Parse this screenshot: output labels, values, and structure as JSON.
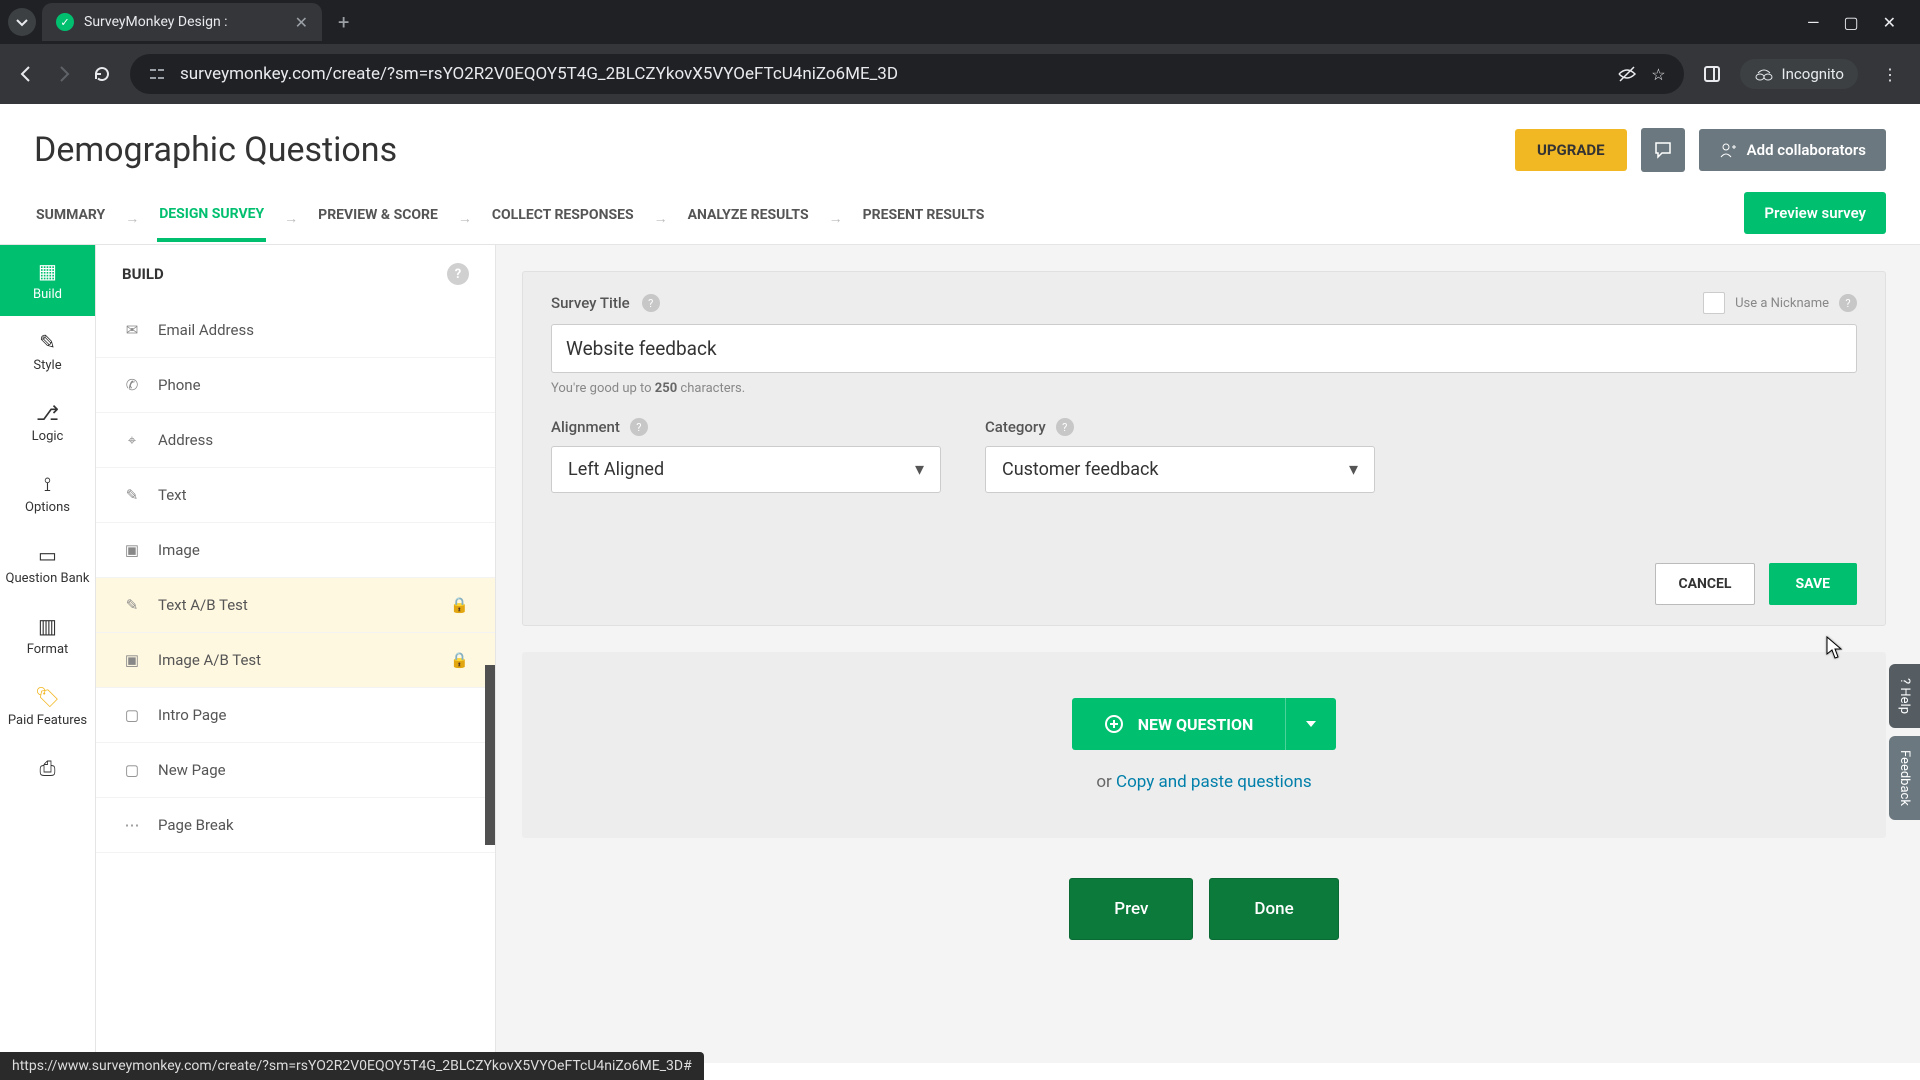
{
  "browser": {
    "tab_title": "SurveyMonkey Design :",
    "url": "surveymonkey.com/create/?sm=rsYO2R2V0EQOY5T4G_2BLCZYkovX5VYOeFTcU4niZo6ME_3D",
    "incognito_label": "Incognito",
    "status_url": "https://www.surveymonkey.com/create/?sm=rsYO2R2V0EQOY5T4G_2BLCZYkovX5VYOeFTcU4niZo6ME_3D#"
  },
  "header": {
    "page_title": "Demographic Questions",
    "upgrade": "UPGRADE",
    "add_collaborators": "Add collaborators"
  },
  "tabs": {
    "items": [
      "SUMMARY",
      "DESIGN SURVEY",
      "PREVIEW & SCORE",
      "COLLECT RESPONSES",
      "ANALYZE RESULTS",
      "PRESENT RESULTS"
    ],
    "preview_btn": "Preview survey"
  },
  "rail": {
    "items": [
      "Build",
      "Style",
      "Logic",
      "Options",
      "Question Bank",
      "Format",
      "Paid Features"
    ],
    "print": "Print"
  },
  "build": {
    "title": "BUILD",
    "items": [
      {
        "label": "Email Address",
        "icon": "✉"
      },
      {
        "label": "Phone",
        "icon": "✆"
      },
      {
        "label": "Address",
        "icon": "⌖"
      },
      {
        "label": "Text",
        "icon": "✎"
      },
      {
        "label": "Image",
        "icon": "▣"
      },
      {
        "label": "Text A/B Test",
        "icon": "✎",
        "premium": true
      },
      {
        "label": "Image A/B Test",
        "icon": "▣",
        "premium": true
      },
      {
        "label": "Intro Page",
        "icon": "▢"
      },
      {
        "label": "New Page",
        "icon": "▢"
      },
      {
        "label": "Page Break",
        "icon": "⋯"
      }
    ]
  },
  "editor": {
    "survey_title_label": "Survey Title",
    "survey_title_value": "Website feedback",
    "nickname_label": "Use a Nickname",
    "helper_prefix": "You're good up to ",
    "helper_count": "250",
    "helper_suffix": " characters.",
    "alignment_label": "Alignment",
    "alignment_value": "Left Aligned",
    "category_label": "Category",
    "category_value": "Customer feedback",
    "cancel": "CANCEL",
    "save": "SAVE"
  },
  "question_block": {
    "new_question": "NEW QUESTION",
    "or": "or ",
    "copy_paste": "Copy and paste questions"
  },
  "nav": {
    "prev": "Prev",
    "done": "Done"
  },
  "side_tabs": {
    "help": "? Help",
    "feedback": "Feedback"
  }
}
